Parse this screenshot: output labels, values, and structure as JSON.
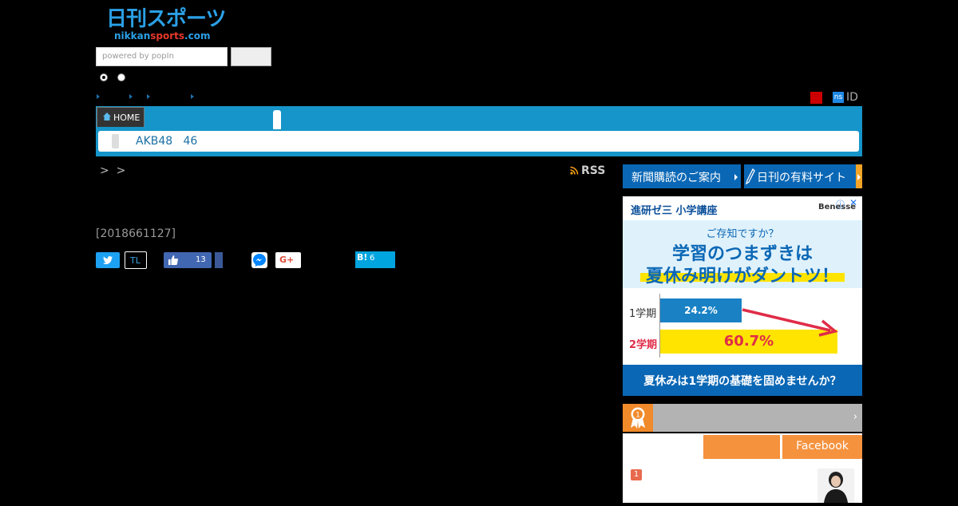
{
  "logo": {
    "jp": "日刊スポーツ",
    "en_a": "nikkan",
    "en_b": "sports",
    "en_c": ".com"
  },
  "search": {
    "placeholder": "powered by popIn"
  },
  "util": {
    "ns_badge": "ns",
    "id_label": "ID"
  },
  "nav": {
    "home": "HOME",
    "sub_label": "AKB48   46"
  },
  "breadcrumb": {
    "text": ">  >",
    "rss": "RSS"
  },
  "article": {
    "date": "[2018661127]"
  },
  "share": {
    "tl": "TL",
    "fb_count": "13",
    "gplus": "G+",
    "hatena": "B!",
    "hatena_count": "6"
  },
  "right": {
    "subscribe": "新聞購読のご案内",
    "paid_site": "日刊の有料サイト",
    "ad": {
      "brand": "進研ゼ三 小学講座",
      "sponsor": "Benesse",
      "question": "ご存知ですか？",
      "headline1": "学習のつまずきは",
      "headline2": "夏休み明けがダントツ！",
      "label1": "1学期",
      "label2": "2学期",
      "value1": "24.2%",
      "value2": "60.7%",
      "footer": "夏休みは1学期の基礎を固めませんか？"
    },
    "tab_facebook": "Facebook",
    "rank_first": "1",
    "rank_medal": "1"
  },
  "colors": {
    "brand_blue": "#1595c9",
    "accent_orange": "#f5923e"
  }
}
